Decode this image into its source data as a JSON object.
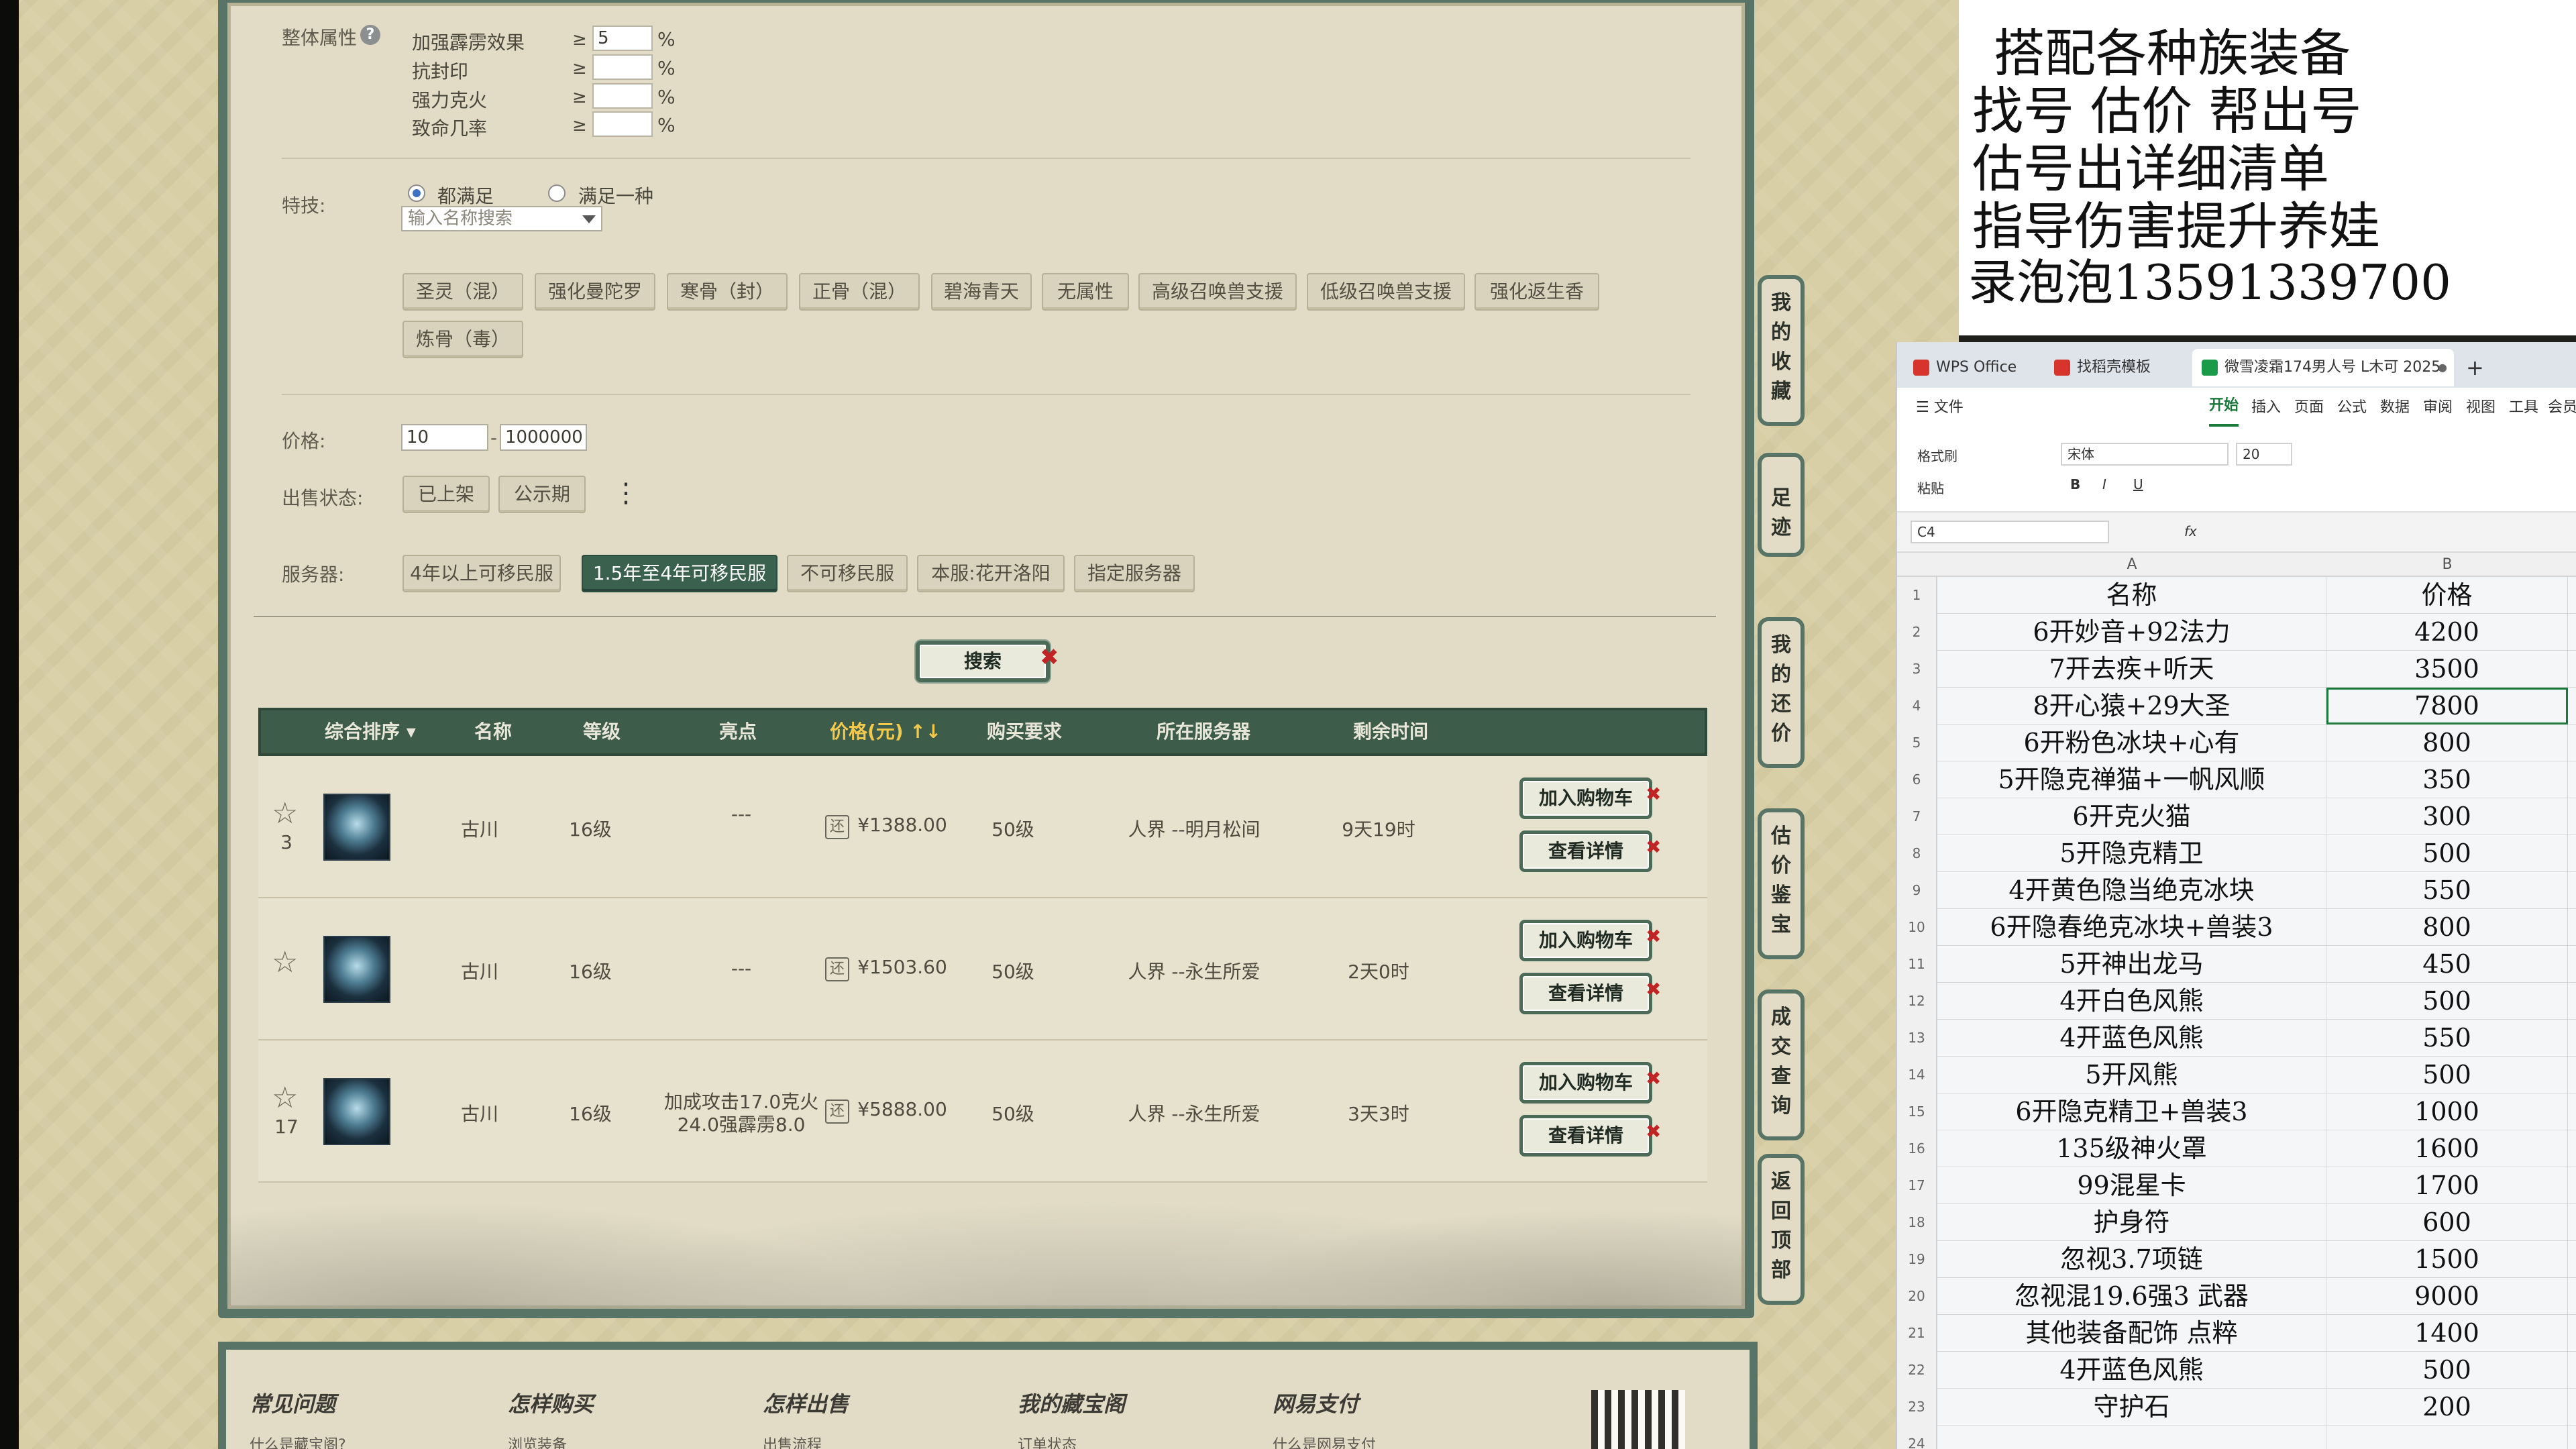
{
  "filters": {
    "overall_label": "整体属性",
    "help_glyph": "?",
    "attrs": [
      {
        "label": "加强霹雳效果",
        "ge": "≥",
        "value": "5",
        "unit": "%"
      },
      {
        "label": "抗封印",
        "ge": "≥",
        "value": "",
        "unit": "%"
      },
      {
        "label": "强力克火",
        "ge": "≥",
        "value": "",
        "unit": "%"
      },
      {
        "label": "致命几率",
        "ge": "≥",
        "value": "",
        "unit": "%"
      }
    ],
    "skill_label": "特技:",
    "radio_all": "都满足",
    "radio_any": "满足一种",
    "skill_placeholder": "输入名称搜索",
    "skill_chips": [
      "圣灵（混）",
      "强化曼陀罗",
      "寒骨（封）",
      "正骨（混）",
      "碧海青天",
      "无属性",
      "高级召唤兽支援",
      "低级召唤兽支援",
      "强化返生香",
      "炼骨（毒）"
    ],
    "price_label": "价格:",
    "price_min": "10",
    "price_dash": "-",
    "price_max": "1000000",
    "status_label": "出售状态:",
    "status_chips": [
      "已上架",
      "公示期"
    ],
    "more_glyph": "⋮",
    "server_label": "服务器:",
    "server_chips": [
      "4年以上可移民服",
      "1.5年至4年可移民服",
      "不可移民服",
      "本服:花开洛阳",
      "指定服务器"
    ],
    "active_server": "1.5年至4年可移民服",
    "search_button": "搜索",
    "close_glyph": "✖"
  },
  "table": {
    "headers": {
      "sort": "综合排序 ▾",
      "name": "名称",
      "level": "等级",
      "highlight": "亮点",
      "price": "价格(元) ↑↓",
      "requirement": "购买要求",
      "server": "所在服务器",
      "time_left": "剩余时间"
    },
    "rows": [
      {
        "fav_count": "3",
        "name": "古川",
        "level": "16级",
        "highlight_1": "---",
        "highlight_2": "",
        "price": "¥1388.00",
        "requirement": "50级",
        "server": "人界 --明月松间",
        "time_left": "9天19时"
      },
      {
        "fav_count": "",
        "name": "古川",
        "level": "16级",
        "highlight_1": "---",
        "highlight_2": "",
        "price": "¥1503.60",
        "requirement": "50级",
        "server": "人界 --永生所爱",
        "time_left": "2天0时"
      },
      {
        "fav_count": "17",
        "name": "古川",
        "level": "16级",
        "highlight_1": "加成攻击17.0克火",
        "highlight_2": "24.0强霹雳8.0",
        "price": "¥5888.00",
        "requirement": "50级",
        "server": "人界 --永生所爱",
        "time_left": "3天3时"
      }
    ],
    "star_glyph": "☆",
    "note_glyph": "还",
    "add_cart": "加入购物车",
    "view_detail": "查看详情"
  },
  "sidenav": [
    "我的收藏",
    "足迹",
    "我的还价",
    "估价鉴宝",
    "成交查询",
    "返回顶部"
  ],
  "footer": {
    "cols": [
      {
        "head": "常见问题",
        "link": "什么是藏宝阁?"
      },
      {
        "head": "怎样购买",
        "link": "浏览装备"
      },
      {
        "head": "怎样出售",
        "link": "出售流程"
      },
      {
        "head": "我的藏宝阁",
        "link": "订单状态"
      },
      {
        "head": "网易支付",
        "link": "什么是网易支付"
      }
    ]
  },
  "ad": [
    "搭配各种族装备",
    "找号  估价  帮出号",
    " 估号出详细清单",
    "指导伤害提升养娃",
    "录泡泡13591339700"
  ],
  "wps": {
    "tabs": [
      {
        "label": "WPS Office",
        "color": "#d6342c"
      },
      {
        "label": "找稻壳模板",
        "color": "#d6342c"
      },
      {
        "label": "微雪凌霜174男人号 L木可 2025",
        "color": "#1a9b4a"
      }
    ],
    "tab_close": "●",
    "new_tab": "+",
    "menu": [
      "☰ 文件",
      "开始",
      "插入",
      "页面",
      "公式",
      "数据",
      "审阅",
      "视图",
      "工具",
      "会员"
    ],
    "active_menu": "开始",
    "toolbar": {
      "format_brush": "格式刷",
      "paste": "粘贴",
      "font": "宋体",
      "size": "20",
      "bold": "B",
      "italic": "I",
      "underline": "U"
    },
    "cell_ref": "C4",
    "fx": "fx",
    "columns": [
      "A",
      "B"
    ],
    "rows": [
      {
        "n": "1",
        "a": "名称",
        "b": "价格"
      },
      {
        "n": "2",
        "a": "6开妙音+92法力",
        "b": "4200"
      },
      {
        "n": "3",
        "a": "7开去疾+听天",
        "b": "3500"
      },
      {
        "n": "4",
        "a": "8开心猿+29大圣",
        "b": "7800"
      },
      {
        "n": "5",
        "a": "6开粉色冰块+心有",
        "b": "800"
      },
      {
        "n": "6",
        "a": "5开隐克禅猫+一帆风顺",
        "b": "350"
      },
      {
        "n": "7",
        "a": "6开克火猫",
        "b": "300"
      },
      {
        "n": "8",
        "a": "5开隐克精卫",
        "b": "500"
      },
      {
        "n": "9",
        "a": "4开黄色隐当绝克冰块",
        "b": "550"
      },
      {
        "n": "10",
        "a": "6开隐春绝克冰块+兽装3",
        "b": "800"
      },
      {
        "n": "11",
        "a": "5开神出龙马",
        "b": "450"
      },
      {
        "n": "12",
        "a": "4开白色风熊",
        "b": "500"
      },
      {
        "n": "13",
        "a": "4开蓝色风熊",
        "b": "550"
      },
      {
        "n": "14",
        "a": "5开风熊",
        "b": "500"
      },
      {
        "n": "15",
        "a": "6开隐克精卫+兽装3",
        "b": "1000"
      },
      {
        "n": "16",
        "a": "135级神火罩",
        "b": "1600"
      },
      {
        "n": "17",
        "a": "99混星卡",
        "b": "1700"
      },
      {
        "n": "18",
        "a": "护身符",
        "b": "600"
      },
      {
        "n": "19",
        "a": "忽视3.7项链",
        "b": "1500"
      },
      {
        "n": "20",
        "a": "忽视混19.6强3 武器",
        "b": "9000"
      },
      {
        "n": "21",
        "a": "其他装备配饰  点粹",
        "b": "1400"
      },
      {
        "n": "22",
        "a": "4开蓝色风熊",
        "b": "500"
      },
      {
        "n": "23",
        "a": "守护石",
        "b": "200"
      },
      {
        "n": "24",
        "a": "",
        "b": ""
      }
    ]
  }
}
